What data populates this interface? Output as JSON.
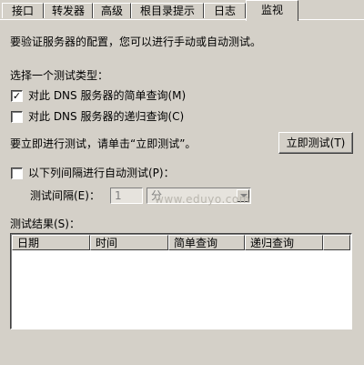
{
  "tabs": [
    {
      "label": "接口"
    },
    {
      "label": "转发器"
    },
    {
      "label": "高级"
    },
    {
      "label": "根目录提示"
    },
    {
      "label": "日志"
    },
    {
      "label": "监视"
    }
  ],
  "intro_text": "要验证服务器的配置，您可以进行手动或自动测试。",
  "test_type_label": "选择一个测试类型：",
  "simple_query": {
    "checked": true,
    "label": "对此 DNS 服务器的简单查询(M)"
  },
  "recursive_query": {
    "checked": false,
    "label": "对此 DNS 服务器的递归查询(C)"
  },
  "immediate_hint": "要立即进行测试，请单击“立即测试”。",
  "test_now_button": "立即测试(T)",
  "auto_test": {
    "checked": false,
    "label": "以下列间隔进行自动测试(P)："
  },
  "interval_label": "测试间隔(E)：",
  "interval_value": "1",
  "interval_unit": "分",
  "watermark": "www.eduyo.com",
  "results_label": "测试结果(S)：",
  "results_columns": [
    "日期",
    "时间",
    "简单查询",
    "递归查询"
  ]
}
